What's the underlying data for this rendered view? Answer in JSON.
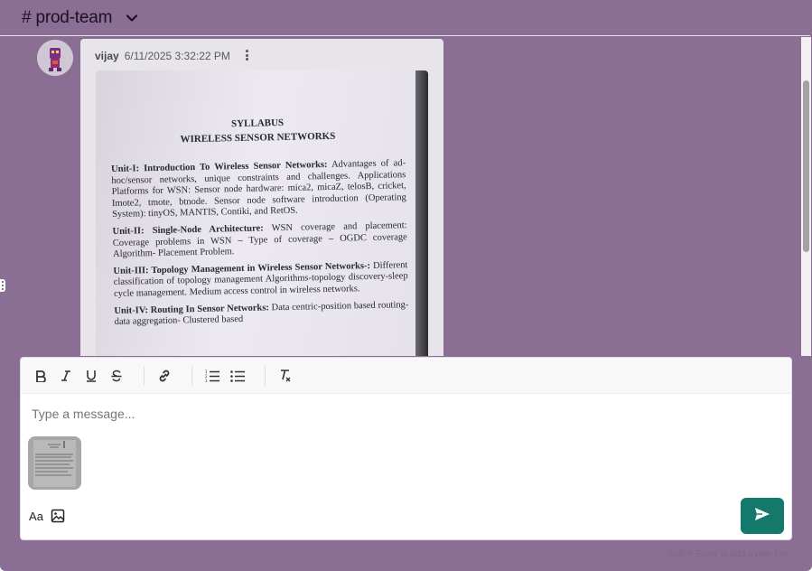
{
  "header": {
    "channel_name": "# prod-team"
  },
  "message": {
    "author": "vijay",
    "timestamp": "6/11/2025 3:32:22 PM",
    "document": {
      "title": "SYLLABUS",
      "subtitle": "WIRELESS SENSOR NETWORKS",
      "units": [
        {
          "heading": "Unit-I:  Introduction To Wireless Sensor Networks:",
          "body": " Advantages of ad-hoc/sensor networks, unique constraints and challenges. Applications Platforms for WSN: Sensor node hardware: mica2, micaZ, telosB, cricket, Imote2, tmote, btnode. Sensor node software introduction (Operating System): tinyOS, MANTIS, Contiki, and RetOS."
        },
        {
          "heading": "Unit-II: Single-Node Architecture:",
          "body": " WSN coverage and placement: Coverage problems in WSN – Type of coverage – OGDC coverage Algorithm- Placement Problem."
        },
        {
          "heading": "Unit-III: Topology Management in Wireless Sensor Networks-:",
          "body": " Different classification of topology management Algorithms-topology discovery-sleep cycle management. Medium access control in wireless networks."
        },
        {
          "heading": "Unit-IV: Routing In Sensor Networks:",
          "body": " Data centric-position based routing- data aggregation- Clustered based"
        }
      ]
    }
  },
  "composer": {
    "placeholder": "Type a message...",
    "toolbar": [
      "bold",
      "italic",
      "underline",
      "strikethrough",
      "link",
      "ordered-list",
      "bullet-list",
      "clear-format"
    ],
    "format_label": "Aa",
    "hint": "Shift + Enter to add a new line"
  },
  "colors": {
    "background": "#8a6e93",
    "send_button": "#14796a"
  }
}
